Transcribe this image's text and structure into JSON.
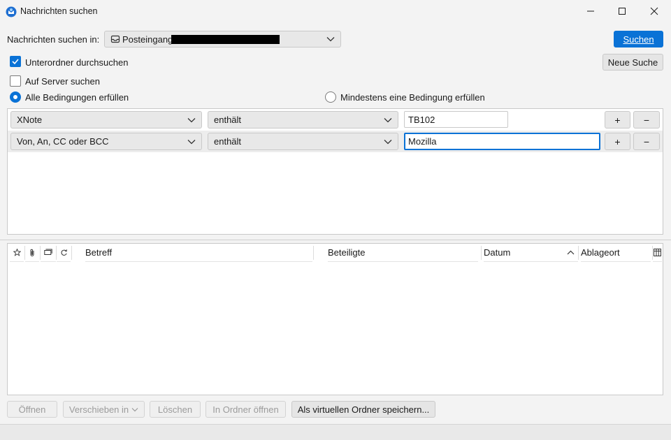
{
  "window": {
    "title": "Nachrichten suchen",
    "controls": {
      "minimize": "minimize-icon",
      "maximize": "maximize-icon",
      "close": "close-icon"
    }
  },
  "search_in": {
    "label": "Nachrichten suchen in:",
    "folder": "Posteingang",
    "folder_icon": "inbox-icon"
  },
  "buttons": {
    "search": "Suchen",
    "new_search": "Neue Suche"
  },
  "options": {
    "subfolders": {
      "label": "Unterordner durchsuchen",
      "checked": true
    },
    "server": {
      "label": "Auf Server suchen",
      "checked": false
    },
    "match_all": {
      "label": "Alle Bedingungen erfüllen",
      "selected": true
    },
    "match_any": {
      "label": "Mindestens eine Bedingung erfüllen",
      "selected": false
    }
  },
  "criteria": [
    {
      "field": "XNote",
      "operator": "enthält",
      "value": "TB102",
      "add": "+",
      "remove": "−"
    },
    {
      "field": "Von, An, CC oder BCC",
      "operator": "enthält",
      "value": "Mozilla",
      "add": "+",
      "remove": "−"
    }
  ],
  "results": {
    "icon_columns": [
      "star-icon",
      "attachment-icon",
      "thread-icon",
      "read-status-icon"
    ],
    "columns": {
      "subject": "Betreff",
      "participants": "Beteiligte",
      "date": "Datum",
      "location": "Ablageort"
    },
    "sort_indicator": "chevron-up-icon",
    "column_picker": "column-picker-icon"
  },
  "actions": {
    "open": "Öffnen",
    "move": "Verschieben in",
    "delete": "Löschen",
    "open_in_folder": "In Ordner öffnen",
    "save_virtual": "Als virtuellen Ordner speichern..."
  },
  "colors": {
    "accent": "#0a72d6",
    "background": "#f3f3f3"
  }
}
